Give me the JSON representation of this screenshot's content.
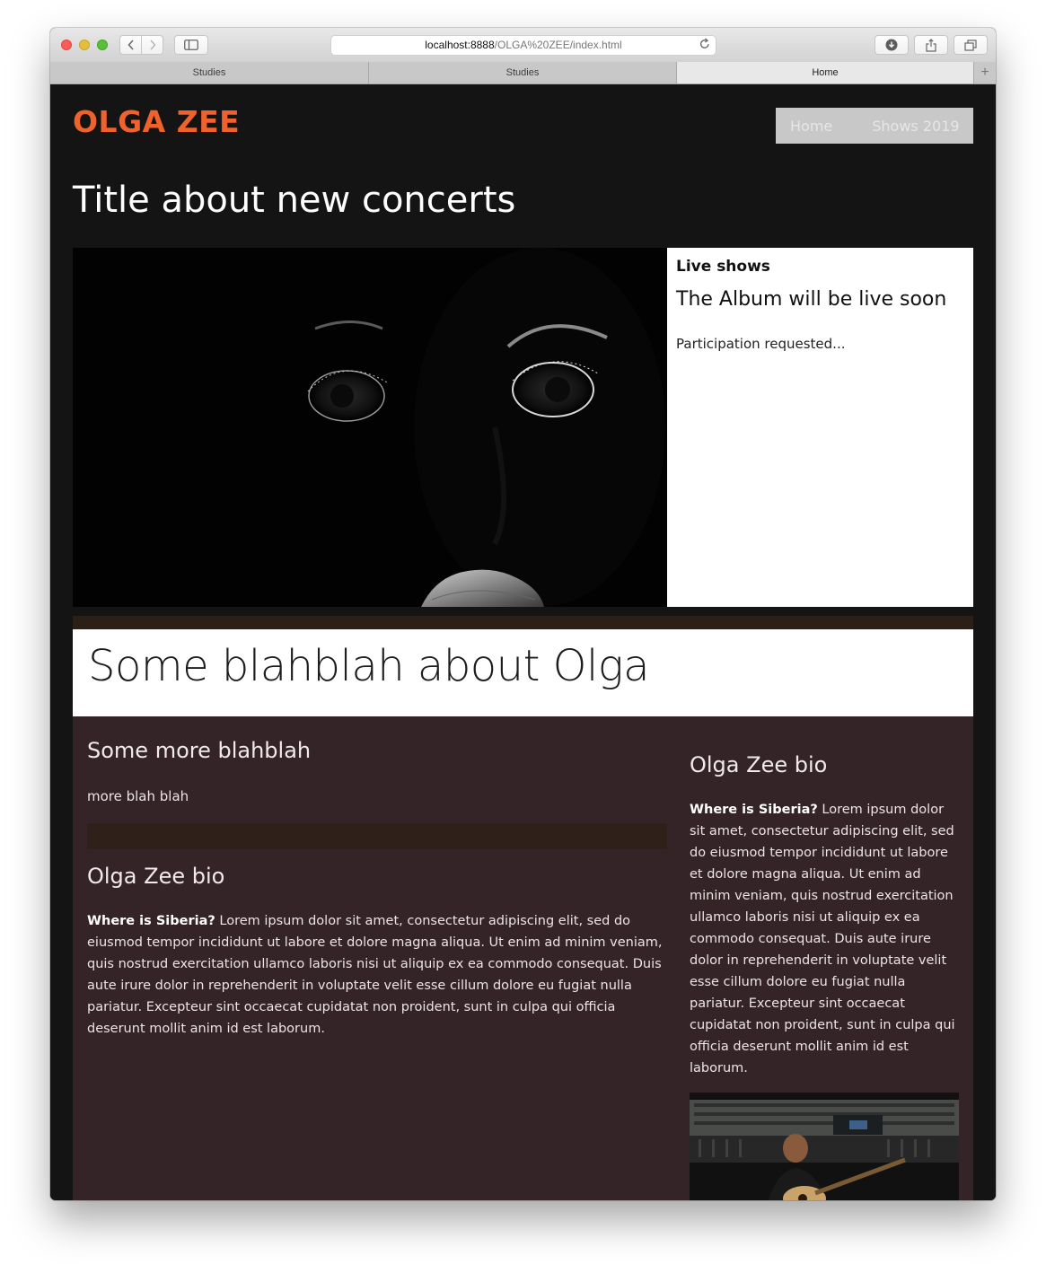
{
  "browser": {
    "url_host": "localhost:8888",
    "url_path": "/OLGA%20ZEE/index.html",
    "tabs": [
      "Studies",
      "Studies",
      "Home"
    ],
    "new_tab_label": "+"
  },
  "site": {
    "logo": "OLGA ZEE",
    "logo_color": "#f0622c",
    "nav": [
      "Home",
      "Shows 2019"
    ]
  },
  "hero": {
    "title": "Title about new concerts",
    "card": {
      "kicker": "Live shows",
      "heading": "The Album will be live soon",
      "text": "Participation requested..."
    }
  },
  "about": {
    "title": "Some blahblah about Olga",
    "left": {
      "heading": "Some more blahblah",
      "text": "more blah blah",
      "bio_heading": "Olga Zee bio",
      "bio_lead": "Where is Siberia?",
      "bio_body": " Lorem ipsum dolor sit amet, consectetur adipiscing elit, sed do eiusmod tempor incididunt ut labore et dolore magna aliqua. Ut enim ad minim veniam, quis nostrud exercitation ullamco laboris nisi ut aliquip ex ea commodo consequat. Duis aute irure dolor in reprehenderit in voluptate velit esse cillum dolore eu fugiat nulla pariatur. Excepteur sint occaecat cupidatat non proident, sunt in culpa qui officia deserunt mollit anim id est laborum."
    },
    "right": {
      "bio_heading": "Olga Zee bio",
      "bio_lead": "Where is Siberia?",
      "bio_body": " Lorem ipsum dolor sit amet, consectetur adipiscing elit, sed do eiusmod tempor incididunt ut labore et dolore magna aliqua. Ut enim ad minim veniam, quis nostrud exercitation ullamco laboris nisi ut aliquip ex ea commodo consequat. Duis aute irure dolor in reprehenderit in voluptate velit esse cillum dolore eu fugiat nulla pariatur. Excepteur sint occaecat cupidatat non proident, sunt in culpa qui officia deserunt mollit anim id est laborum."
    }
  }
}
